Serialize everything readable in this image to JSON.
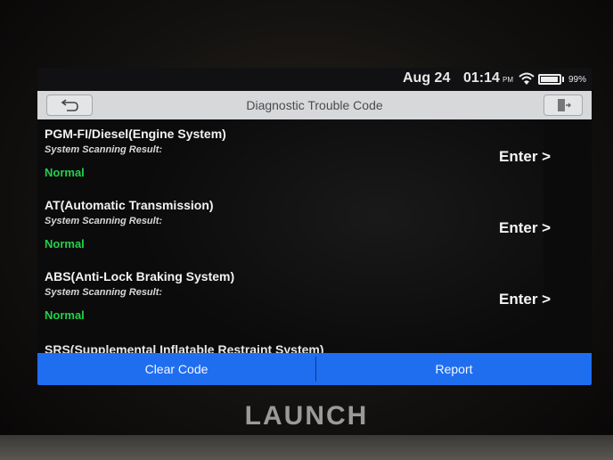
{
  "statusbar": {
    "date": "Aug 24",
    "time": "01:14",
    "ampm": "PM",
    "battery": "99%"
  },
  "header": {
    "title": "Diagnostic Trouble Code"
  },
  "systems": [
    {
      "name": "PGM-FI/Diesel(Engine System)",
      "subtitle": "System Scanning Result:",
      "status": "Normal",
      "action": "Enter >"
    },
    {
      "name": "AT(Automatic Transmission)",
      "subtitle": "System Scanning Result:",
      "status": "Normal",
      "action": "Enter >"
    },
    {
      "name": "ABS(Anti-Lock Braking System)",
      "subtitle": "System Scanning Result:",
      "status": "Normal",
      "action": "Enter >"
    },
    {
      "name": "SRS(Supplemental Inflatable Restraint System)"
    }
  ],
  "footer": {
    "clear_label": "Clear Code",
    "report_label": "Report"
  },
  "device": {
    "brand": "LAUNCH"
  },
  "colors": {
    "accent": "#1f6ef0",
    "status_normal": "#22d04a",
    "titlebar": "#d7d8da"
  },
  "icons": {
    "back": "back-arrow-icon",
    "exit": "exit-icon",
    "wifi": "wifi-icon",
    "battery": "battery-icon"
  }
}
